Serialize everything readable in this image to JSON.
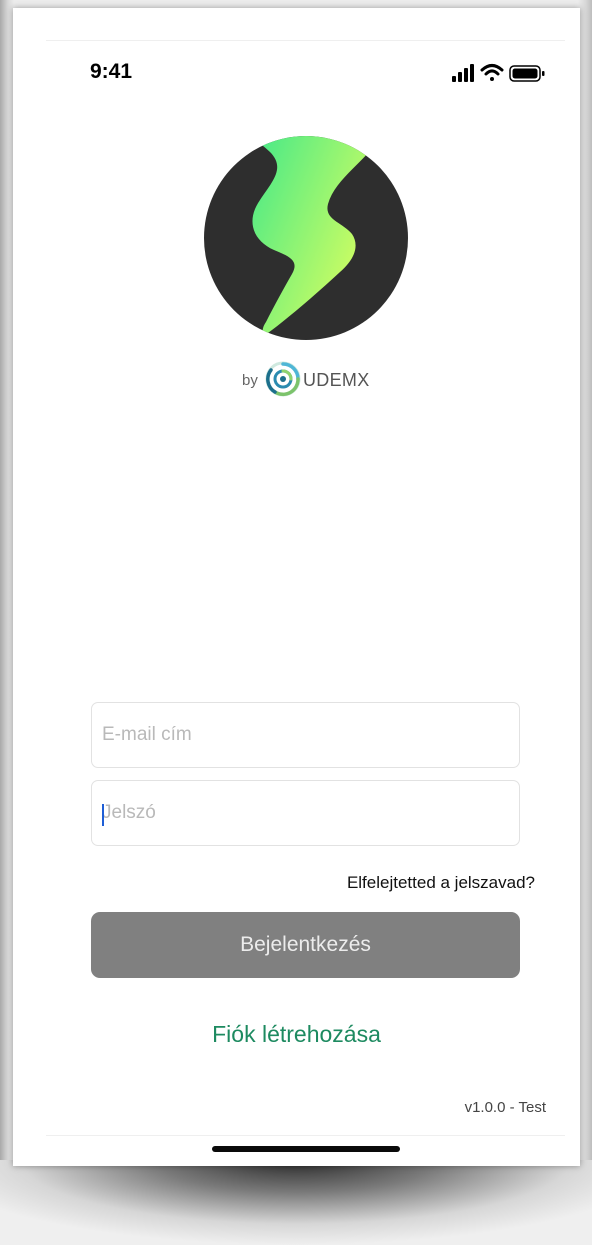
{
  "status_bar": {
    "time": "9:41",
    "icons": [
      "cellular-signal-icon",
      "wifi-icon",
      "battery-icon"
    ]
  },
  "branding": {
    "by_label": "by",
    "company_name": "UDEMX",
    "logo_colors": {
      "disc": "#2e2e2e",
      "bolt_start": "#3fe88a",
      "bolt_end": "#dcff5e"
    }
  },
  "login_form": {
    "email_placeholder": "E-mail cím",
    "password_placeholder": "Jelszó",
    "forgot_password_label": "Elfelejtetted a jelszavad?",
    "submit_label": "Bejelentkezés",
    "create_account_label": "Fiók létrehozása"
  },
  "footer": {
    "version": "v1.0.0 - Test"
  },
  "colors": {
    "accent_green": "#1d8a60",
    "button_disabled": "#808080",
    "caret": "#1e5ed6"
  }
}
